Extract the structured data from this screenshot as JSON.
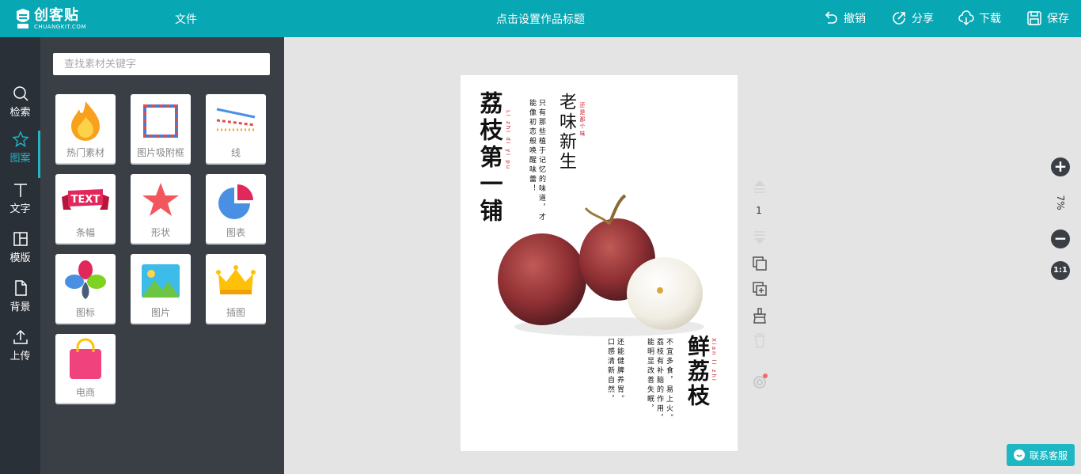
{
  "topbar": {
    "logo_main": "创客贴",
    "logo_sub": "CHUANGKIT.COM",
    "file_menu": "文件",
    "doc_title": "点击设置作品标题",
    "undo": "撤销",
    "share": "分享",
    "download": "下载",
    "save": "保存"
  },
  "nav": {
    "items": [
      {
        "label": "检索",
        "icon": "search-icon"
      },
      {
        "label": "图案",
        "icon": "star-icon"
      },
      {
        "label": "文字",
        "icon": "text-icon"
      },
      {
        "label": "模版",
        "icon": "template-icon"
      },
      {
        "label": "背景",
        "icon": "background-icon"
      },
      {
        "label": "上传",
        "icon": "upload-icon"
      }
    ],
    "active_index": 1
  },
  "panel": {
    "search_placeholder": "查找素材关键字",
    "tiles": [
      {
        "label": "热门素材"
      },
      {
        "label": "图片吸附框"
      },
      {
        "label": "线"
      },
      {
        "label": "条幅"
      },
      {
        "label": "形状"
      },
      {
        "label": "图表"
      },
      {
        "label": "图标"
      },
      {
        "label": "图片"
      },
      {
        "label": "插图"
      },
      {
        "label": "电商"
      }
    ]
  },
  "canvas": {
    "title_main": "荔枝第一铺",
    "pinyin_main": "Li zhi di yi pu",
    "title_sub1": "老味新生",
    "pinyin_sub1": "还是那个味",
    "text_block1": "只有那些植于记忆的味道，才能像初恋般唤醒味蕾！",
    "title_sub2": "鲜荔枝",
    "pinyin_sub2": "Xian li zhi",
    "text_block2": "还能健脾养胃。口感清新自然，",
    "text_block3": "不宜多食，易上火。荔枝有补脑的作用，能明显改善失眠，",
    "banner_text": "TEXT"
  },
  "tools": {
    "page_number": "1",
    "zoom_level": "7%",
    "zoom_reset": "1:1"
  },
  "contact": {
    "label": "联系客服"
  },
  "colors": {
    "brand": "#07a7b3",
    "nav_bg": "#2a3038",
    "panel_bg": "#3a3f46",
    "accent_red": "#c8202c"
  }
}
